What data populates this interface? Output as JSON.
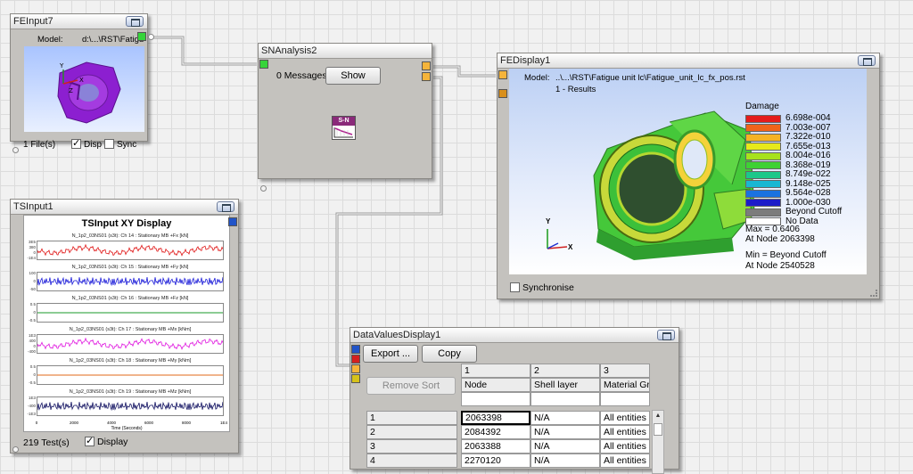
{
  "feinput": {
    "title": "FEInput7",
    "model_label": "Model:",
    "model_path": "d:\\...\\RST\\Fatigue",
    "files": "1 File(s)",
    "disp_label": "Disp",
    "sync_label": "Sync"
  },
  "snanalysis": {
    "title": "SNAnalysis2",
    "messages": "0 Messages",
    "show_label": "Show",
    "icon_label": "S-N"
  },
  "fedisplay": {
    "title": "FEDisplay1",
    "model_label": "Model:",
    "model_path": "..\\...\\RST\\Fatigue unit lc\\Fatigue_unit_lc_fx_pos.rst",
    "results_line": "1 - Results",
    "legend_title": "Damage",
    "legend": [
      {
        "color": "#e41c1c",
        "label": "6.698e-004"
      },
      {
        "color": "#f0641a",
        "label": "7.003e-007"
      },
      {
        "color": "#f5b324",
        "label": "7.322e-010"
      },
      {
        "color": "#e7e91a",
        "label": "7.655e-013"
      },
      {
        "color": "#a7e21c",
        "label": "8.004e-016"
      },
      {
        "color": "#3ed134",
        "label": "8.368e-019"
      },
      {
        "color": "#1bc88a",
        "label": "8.749e-022"
      },
      {
        "color": "#19b7d2",
        "label": "9.148e-025"
      },
      {
        "color": "#1a72e0",
        "label": "9.564e-028"
      },
      {
        "color": "#1c1cc9",
        "label": "1.000e-030"
      },
      {
        "color": "#7c7c7c",
        "label": "Beyond Cutoff"
      },
      {
        "color": "#ffffff",
        "label": "No Data"
      }
    ],
    "max_line1": "Max = 0.6406",
    "max_line2": "At Node 2063398",
    "min_line1": "Min = Beyond Cutoff",
    "min_line2": "At Node 2540528",
    "axis_y": "Y",
    "axis_x": "X",
    "synchronise": "Synchronise"
  },
  "tsinput": {
    "title": "TSInput1",
    "chart_title": "TSInput XY Display",
    "tests": "219 Test(s)",
    "display_label": "Display",
    "x_axis_label": "Time (Seconds)",
    "x_ticks": [
      "0",
      "2000",
      "4000",
      "6000",
      "8000",
      "1E4"
    ],
    "channels": [
      {
        "caption": "N_1p2_03NS01 (s3t): Ch 14 : Stationary MB +Fx [kN]",
        "color": "#e01818",
        "ticks": [
          "3E5",
          "380",
          "0",
          "-1E4"
        ]
      },
      {
        "caption": "N_1p2_03NS01 (s3t): Ch 15 : Stationary MB +Fy [kN]",
        "color": "#1818d8",
        "ticks": [
          "100",
          "0",
          "-50"
        ]
      },
      {
        "caption": "N_1p2_03NS01 (s3t): Ch 16 : Stationary MB +Fz [kN]",
        "color": "#1a9a2a",
        "ticks": [
          "0.5",
          "0",
          "-0.5"
        ]
      },
      {
        "caption": "N_1p2_03NS01 (s3t): Ch 17 : Stationary MB +Mx [kNm]",
        "color": "#e018e0",
        "ticks": [
          "1E3",
          "400",
          "0",
          "-400"
        ]
      },
      {
        "caption": "N_1p2_03NS01 (s3t): Ch 18 : Stationary MB +My [kNm]",
        "color": "#e06a18",
        "ticks": [
          "0.5",
          "0",
          "-0.5"
        ]
      },
      {
        "caption": "N_1p2_03NS01 (s3t): Ch 19 : Stationary MB +Mz [kNm]",
        "color": "#101060",
        "ticks": [
          "1E3",
          "-400",
          "-1E3"
        ]
      }
    ]
  },
  "datavalues": {
    "title": "DataValuesDisplay1",
    "export_label": "Export ...",
    "copy_label": "Copy",
    "remove_sort_label": "Remove Sort",
    "col_numbers": [
      "1",
      "2",
      "3"
    ],
    "col_names": [
      "Node",
      "Shell layer",
      "Material Grou"
    ],
    "rows": [
      {
        "index": "1",
        "node": "2063398",
        "shell": "N/A",
        "material": "All entities"
      },
      {
        "index": "2",
        "node": "2084392",
        "shell": "N/A",
        "material": "All entities"
      },
      {
        "index": "3",
        "node": "2063388",
        "shell": "N/A",
        "material": "All entities"
      },
      {
        "index": "4",
        "node": "2270120",
        "shell": "N/A",
        "material": "All entities"
      }
    ]
  }
}
